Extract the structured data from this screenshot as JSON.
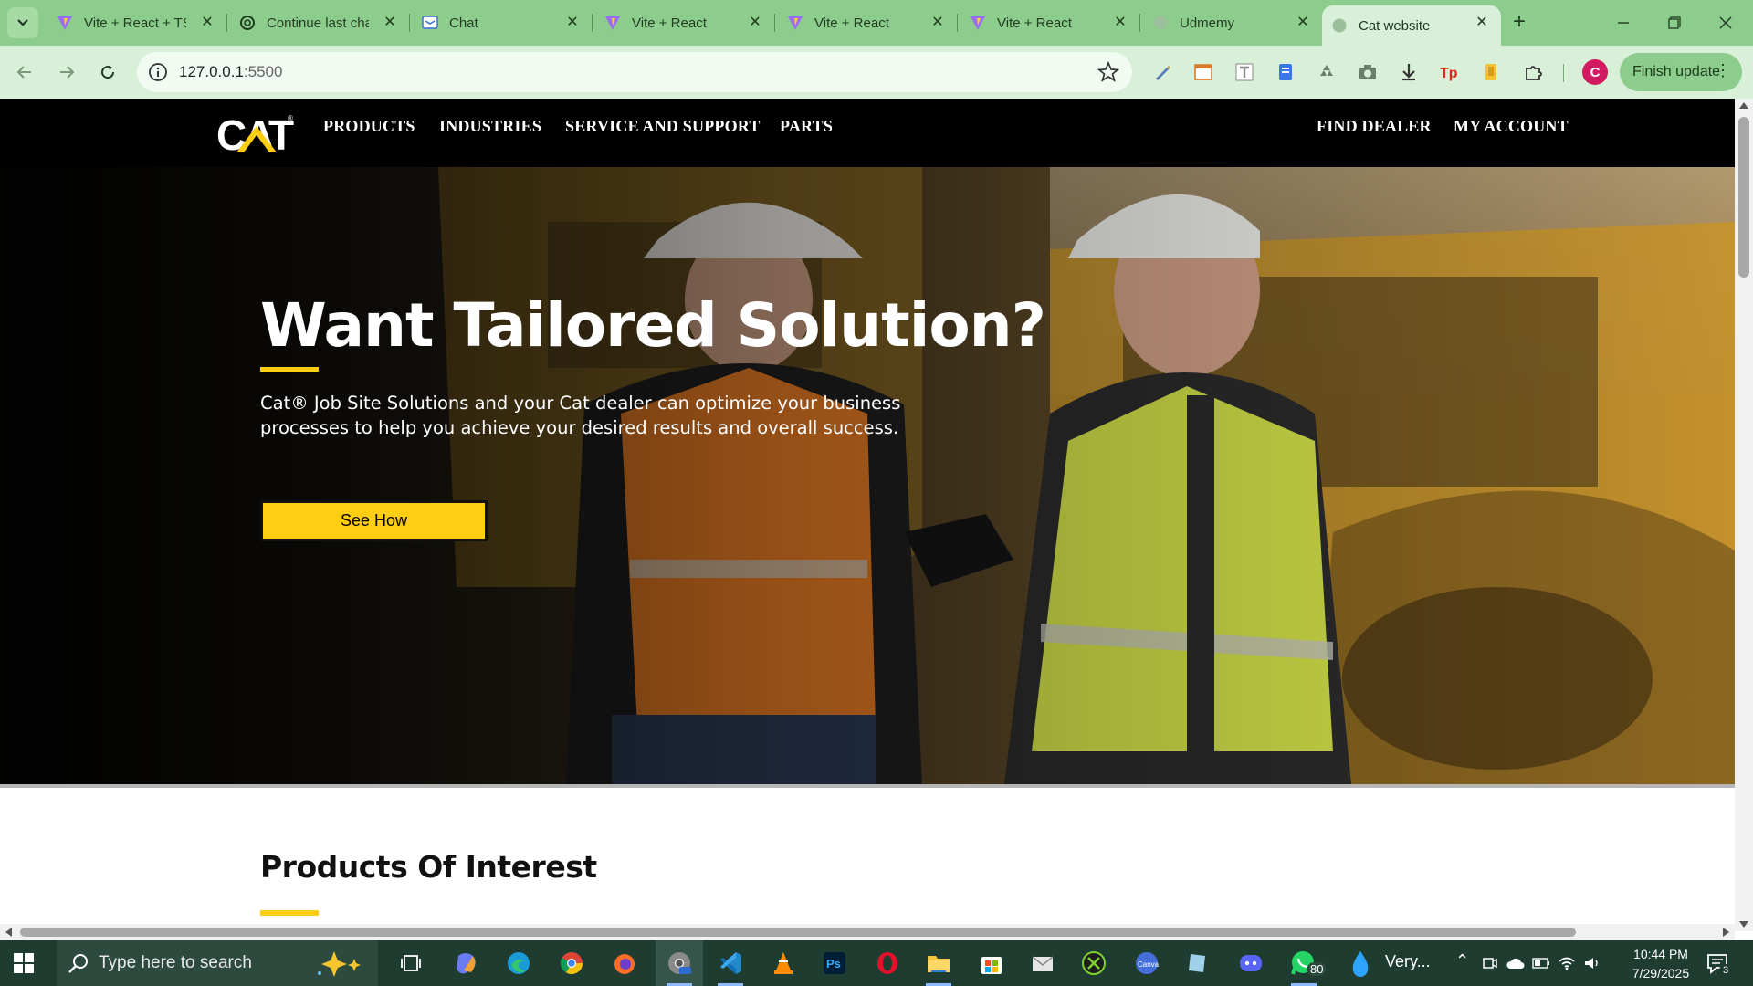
{
  "browser": {
    "tabs": [
      {
        "title": "Vite + React + TS",
        "favicon": "vite-icon"
      },
      {
        "title": "Continue last chat",
        "favicon": "openai-icon"
      },
      {
        "title": "Chat",
        "favicon": "chat-icon"
      },
      {
        "title": "Vite + React",
        "favicon": "vite-icon"
      },
      {
        "title": "Vite + React",
        "favicon": "vite-icon"
      },
      {
        "title": "Vite + React",
        "favicon": "vite-icon"
      },
      {
        "title": "Udmemy",
        "favicon": "globe-icon"
      },
      {
        "title": "Cat website",
        "favicon": "globe-icon",
        "active": true
      }
    ],
    "address": {
      "host": "127.0.0.1",
      "port": ":5500"
    },
    "avatar_letter": "C",
    "finish_update_label": "Finish update"
  },
  "site": {
    "nav": {
      "logo_text": "CAT",
      "links": [
        "PRODUCTS",
        "INDUSTRIES",
        "SERVICE AND SUPPORT",
        "PARTS"
      ],
      "right_links": [
        "FIND DEALER",
        "MY ACCOUNT"
      ]
    },
    "hero": {
      "title": "Want Tailored Solution?",
      "body": "Cat® Job Site Solutions and your Cat dealer can optimize your business processes to help you achieve your desired results and overall success.",
      "cta_label": "See How"
    },
    "products": {
      "title": "Products Of Interest"
    },
    "accent_color": "#FFCD11"
  },
  "taskbar": {
    "search_placeholder": "Type here to search",
    "weather_text": "Very...",
    "whatsapp_badge": "80",
    "time": "10:44 PM",
    "date": "7/29/2025",
    "notification_count": "3"
  }
}
